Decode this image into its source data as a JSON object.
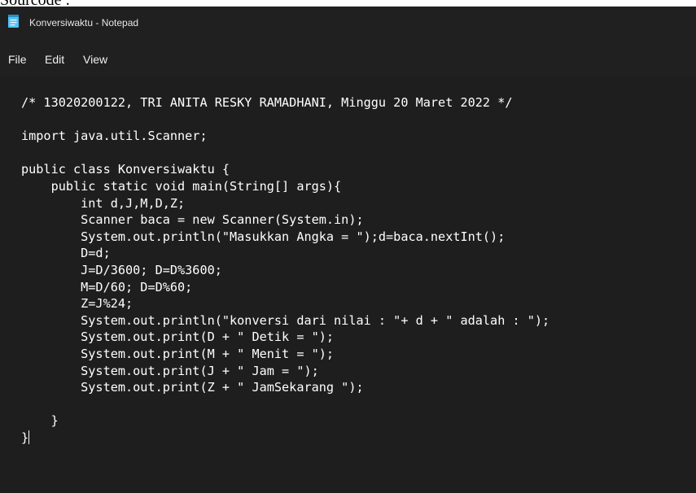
{
  "document_caption": "Sourcode :",
  "window": {
    "title": "Konversiwaktu - Notepad",
    "app_icon": "notepad-icon"
  },
  "menu": {
    "items": [
      {
        "label": "File"
      },
      {
        "label": "Edit"
      },
      {
        "label": "View"
      }
    ]
  },
  "editor": {
    "lines": [
      "/* 13020200122, TRI ANITA RESKY RAMADHANI, Minggu 20 Maret 2022 */",
      "",
      "import java.util.Scanner;",
      "",
      "public class Konversiwaktu {",
      "    public static void main(String[] args){",
      "        int d,J,M,D,Z;",
      "        Scanner baca = new Scanner(System.in);",
      "        System.out.println(\"Masukkan Angka = \");d=baca.nextInt();",
      "        D=d;",
      "        J=D/3600; D=D%3600;",
      "        M=D/60; D=D%60;",
      "        Z=J%24;",
      "        System.out.println(\"konversi dari nilai : \"+ d + \" adalah : \");",
      "        System.out.print(D + \" Detik = \");",
      "        System.out.print(M + \" Menit = \");",
      "        System.out.print(J + \" Jam = \");",
      "        System.out.print(Z + \" JamSekarang \");",
      "",
      "    }",
      "}"
    ]
  },
  "colors": {
    "editor_background": "#1e1e1e",
    "chrome_background": "#202020",
    "text": "#ffffff",
    "icon_accent": "#4fc3f7"
  }
}
